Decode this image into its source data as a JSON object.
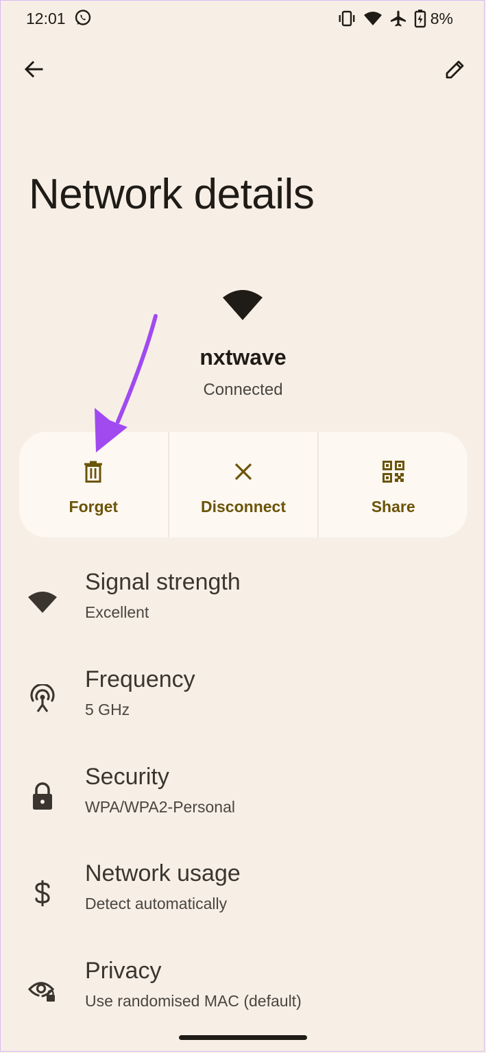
{
  "status_bar": {
    "time": "12:01",
    "battery_percent": "8%",
    "icons": [
      "whatsapp-icon",
      "vibrate-icon",
      "wifi-icon",
      "airplane-icon",
      "battery-charging-icon"
    ]
  },
  "header": {
    "back_icon": "arrow-left-icon",
    "edit_icon": "pencil-icon"
  },
  "page": {
    "title": "Network details"
  },
  "network": {
    "icon": "wifi-icon",
    "name": "nxtwave",
    "status": "Connected"
  },
  "actions": [
    {
      "label": "Forget",
      "icon": "trash-icon"
    },
    {
      "label": "Disconnect",
      "icon": "close-icon"
    },
    {
      "label": "Share",
      "icon": "qr-code-icon"
    }
  ],
  "details": [
    {
      "title": "Signal strength",
      "value": "Excellent",
      "icon": "wifi-signal-icon"
    },
    {
      "title": "Frequency",
      "value": "5 GHz",
      "icon": "antenna-icon"
    },
    {
      "title": "Security",
      "value": "WPA/WPA2-Personal",
      "icon": "lock-icon"
    },
    {
      "title": "Network usage",
      "value": "Detect automatically",
      "icon": "dollar-icon"
    },
    {
      "title": "Privacy",
      "value": "Use randomised MAC (default)",
      "icon": "eye-lock-icon"
    }
  ],
  "colors": {
    "background": "#f7efe6",
    "card": "#fdf8f2",
    "accent": "#6b5408",
    "annotation_arrow": "#a04af0"
  }
}
